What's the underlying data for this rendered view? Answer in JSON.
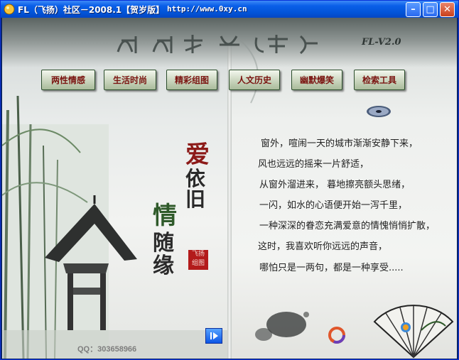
{
  "window": {
    "title": "FL（飞扬）社区－2008.1【贺岁版】",
    "url": "http://www.0xy.cn",
    "buttons": {
      "minimize": "–",
      "maximize": "□",
      "close": "✕"
    }
  },
  "header": {
    "version": "FL-V2.0"
  },
  "nav": [
    {
      "label": "两性情感"
    },
    {
      "label": "生活时尚"
    },
    {
      "label": "精彩组图"
    },
    {
      "label": "人文历史"
    },
    {
      "label": "幽默爆笑"
    },
    {
      "label": "检索工具"
    }
  ],
  "poem": [
    "窗外，喧闹一天的城市渐渐安静下来，",
    "风也远远的摇来一片舒适，",
    "从窗外溜进来，  暮地擦亮额头思绪，",
    "一闪，如水的心语便开始一泻千里，",
    "一种深深的眷恋充满爱意的情愧悄悄扩散，",
    "这时，我喜欢听你远远的声音，",
    "哪怕只是一两句，都是一种享受....."
  ],
  "calligraphy": {
    "column1": "爱依旧",
    "column2": "情随缘",
    "stamp": "飞扬组图"
  },
  "footer": {
    "qq": "QQ：303658966"
  },
  "icons": {
    "app": "fl-app-icon",
    "cd": "music-cd-icon",
    "play": "play-next-icon",
    "refresh": "refresh-icon",
    "fan": "folding-fan-icon"
  },
  "colors": {
    "titlebar": "#0a5fe8",
    "nav_text": "#7a1410",
    "accent_red": "#8c1a18",
    "accent_green": "#2f5a2a",
    "ink": "#222222"
  }
}
